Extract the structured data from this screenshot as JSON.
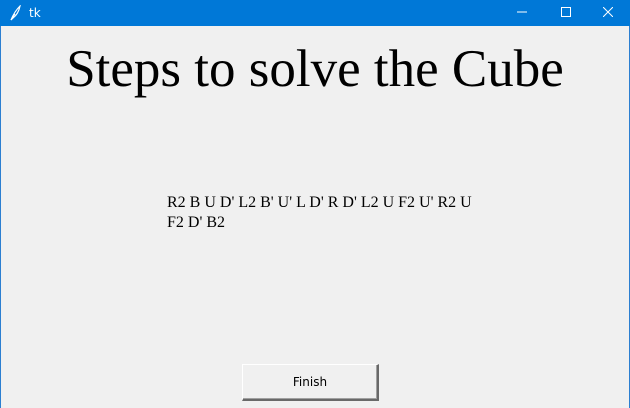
{
  "window": {
    "title": "tk",
    "icon": "feather-icon",
    "controls": [
      "minimize-icon",
      "maximize-icon",
      "close-icon"
    ],
    "titlebar_color": "#0078d7"
  },
  "main": {
    "heading": "Steps to solve the Cube",
    "moves_text": "R2 B U D' L2 B' U' L D' R D' L2 U F2 U' R2 U F2 D' B2",
    "finish_label": "Finish"
  }
}
